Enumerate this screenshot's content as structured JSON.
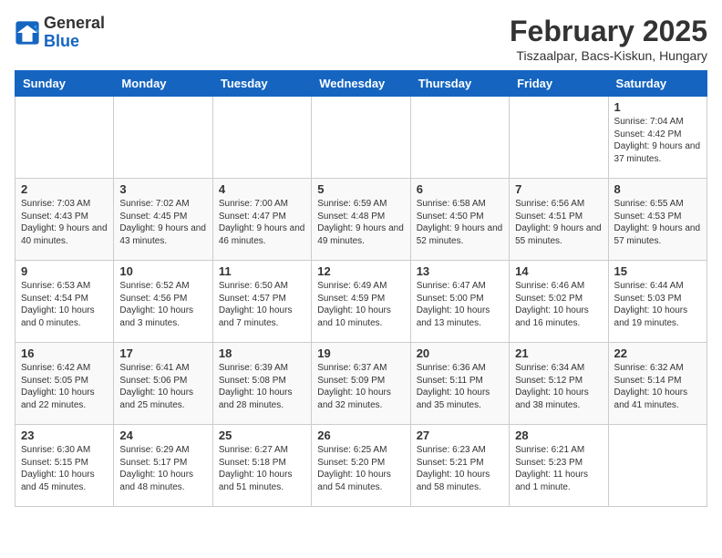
{
  "header": {
    "logo_general": "General",
    "logo_blue": "Blue",
    "title": "February 2025",
    "subtitle": "Tiszaalpar, Bacs-Kiskun, Hungary"
  },
  "days_of_week": [
    "Sunday",
    "Monday",
    "Tuesday",
    "Wednesday",
    "Thursday",
    "Friday",
    "Saturday"
  ],
  "weeks": [
    [
      {
        "day": "",
        "info": ""
      },
      {
        "day": "",
        "info": ""
      },
      {
        "day": "",
        "info": ""
      },
      {
        "day": "",
        "info": ""
      },
      {
        "day": "",
        "info": ""
      },
      {
        "day": "",
        "info": ""
      },
      {
        "day": "1",
        "info": "Sunrise: 7:04 AM\nSunset: 4:42 PM\nDaylight: 9 hours and 37 minutes."
      }
    ],
    [
      {
        "day": "2",
        "info": "Sunrise: 7:03 AM\nSunset: 4:43 PM\nDaylight: 9 hours and 40 minutes."
      },
      {
        "day": "3",
        "info": "Sunrise: 7:02 AM\nSunset: 4:45 PM\nDaylight: 9 hours and 43 minutes."
      },
      {
        "day": "4",
        "info": "Sunrise: 7:00 AM\nSunset: 4:47 PM\nDaylight: 9 hours and 46 minutes."
      },
      {
        "day": "5",
        "info": "Sunrise: 6:59 AM\nSunset: 4:48 PM\nDaylight: 9 hours and 49 minutes."
      },
      {
        "day": "6",
        "info": "Sunrise: 6:58 AM\nSunset: 4:50 PM\nDaylight: 9 hours and 52 minutes."
      },
      {
        "day": "7",
        "info": "Sunrise: 6:56 AM\nSunset: 4:51 PM\nDaylight: 9 hours and 55 minutes."
      },
      {
        "day": "8",
        "info": "Sunrise: 6:55 AM\nSunset: 4:53 PM\nDaylight: 9 hours and 57 minutes."
      }
    ],
    [
      {
        "day": "9",
        "info": "Sunrise: 6:53 AM\nSunset: 4:54 PM\nDaylight: 10 hours and 0 minutes."
      },
      {
        "day": "10",
        "info": "Sunrise: 6:52 AM\nSunset: 4:56 PM\nDaylight: 10 hours and 3 minutes."
      },
      {
        "day": "11",
        "info": "Sunrise: 6:50 AM\nSunset: 4:57 PM\nDaylight: 10 hours and 7 minutes."
      },
      {
        "day": "12",
        "info": "Sunrise: 6:49 AM\nSunset: 4:59 PM\nDaylight: 10 hours and 10 minutes."
      },
      {
        "day": "13",
        "info": "Sunrise: 6:47 AM\nSunset: 5:00 PM\nDaylight: 10 hours and 13 minutes."
      },
      {
        "day": "14",
        "info": "Sunrise: 6:46 AM\nSunset: 5:02 PM\nDaylight: 10 hours and 16 minutes."
      },
      {
        "day": "15",
        "info": "Sunrise: 6:44 AM\nSunset: 5:03 PM\nDaylight: 10 hours and 19 minutes."
      }
    ],
    [
      {
        "day": "16",
        "info": "Sunrise: 6:42 AM\nSunset: 5:05 PM\nDaylight: 10 hours and 22 minutes."
      },
      {
        "day": "17",
        "info": "Sunrise: 6:41 AM\nSunset: 5:06 PM\nDaylight: 10 hours and 25 minutes."
      },
      {
        "day": "18",
        "info": "Sunrise: 6:39 AM\nSunset: 5:08 PM\nDaylight: 10 hours and 28 minutes."
      },
      {
        "day": "19",
        "info": "Sunrise: 6:37 AM\nSunset: 5:09 PM\nDaylight: 10 hours and 32 minutes."
      },
      {
        "day": "20",
        "info": "Sunrise: 6:36 AM\nSunset: 5:11 PM\nDaylight: 10 hours and 35 minutes."
      },
      {
        "day": "21",
        "info": "Sunrise: 6:34 AM\nSunset: 5:12 PM\nDaylight: 10 hours and 38 minutes."
      },
      {
        "day": "22",
        "info": "Sunrise: 6:32 AM\nSunset: 5:14 PM\nDaylight: 10 hours and 41 minutes."
      }
    ],
    [
      {
        "day": "23",
        "info": "Sunrise: 6:30 AM\nSunset: 5:15 PM\nDaylight: 10 hours and 45 minutes."
      },
      {
        "day": "24",
        "info": "Sunrise: 6:29 AM\nSunset: 5:17 PM\nDaylight: 10 hours and 48 minutes."
      },
      {
        "day": "25",
        "info": "Sunrise: 6:27 AM\nSunset: 5:18 PM\nDaylight: 10 hours and 51 minutes."
      },
      {
        "day": "26",
        "info": "Sunrise: 6:25 AM\nSunset: 5:20 PM\nDaylight: 10 hours and 54 minutes."
      },
      {
        "day": "27",
        "info": "Sunrise: 6:23 AM\nSunset: 5:21 PM\nDaylight: 10 hours and 58 minutes."
      },
      {
        "day": "28",
        "info": "Sunrise: 6:21 AM\nSunset: 5:23 PM\nDaylight: 11 hours and 1 minute."
      },
      {
        "day": "",
        "info": ""
      }
    ]
  ]
}
